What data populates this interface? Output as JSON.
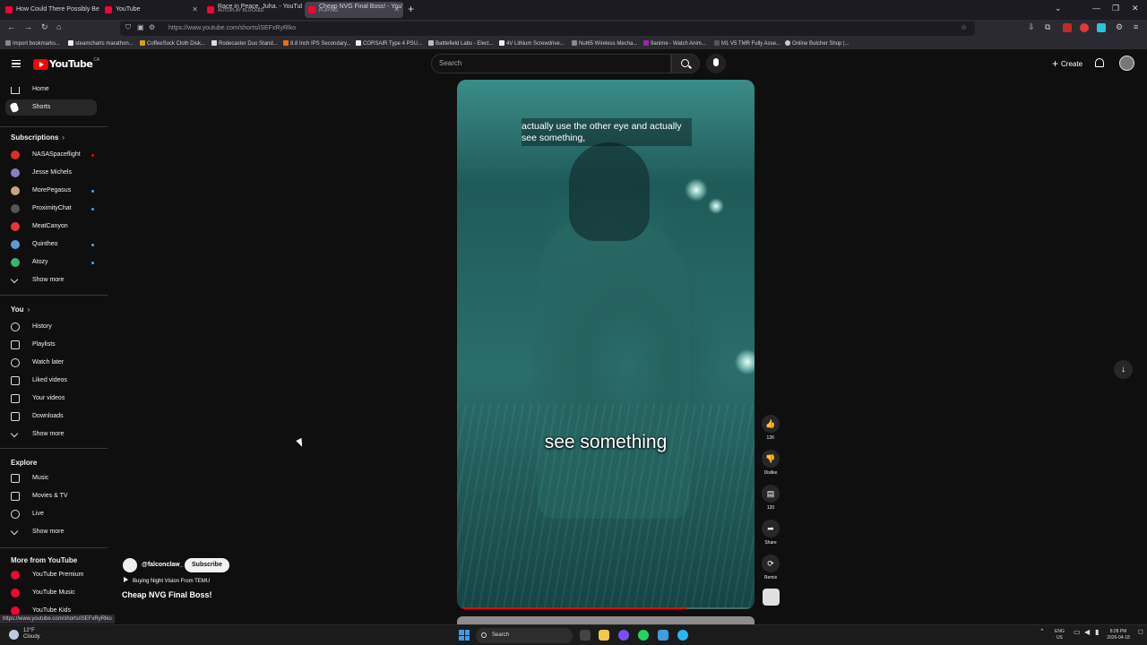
{
  "browser": {
    "tabs": [
      {
        "title": "How Could There Possibly Be A",
        "subtitle": ""
      },
      {
        "title": "YouTube",
        "subtitle": ""
      },
      {
        "title": "Race in Peace, Juha. - YouTube",
        "subtitle": "AUTOPLAY BLOCKED"
      },
      {
        "title": "Cheap NVG Final Boss! - YouTu",
        "subtitle": "PLAYING"
      }
    ],
    "url": "https://www.youtube.com/shorts/iSEFxRyRlko",
    "bookmarks": [
      "Import bookmarks...",
      "steamcharts marathon...",
      "CoffeeSock Cloth Disk...",
      "Rodecaster Duo Stand...",
      "8.8 Inch IPS Secondary...",
      "CORSAIR Type 4 PSU...",
      "Battlefield Labs - Elect...",
      "4V Lithium Screwdrive...",
      "Nut65 Wireless Mecha...",
      "9anime - Watch Anim...",
      "M1 V5 TMR Fully Asse...",
      "Online Butcher Shop |..."
    ],
    "status_url": "https://www.youtube.com/shorts/iSEFxRyRlko"
  },
  "header": {
    "logo_text": "YouTube",
    "region": "CA",
    "search_placeholder": "Search",
    "create_label": "Create"
  },
  "sidebar": {
    "main": [
      {
        "label": "Home"
      },
      {
        "label": "Shorts"
      }
    ],
    "subscriptions_heading": "Subscriptions",
    "subscriptions": [
      {
        "label": "NASASpaceflight",
        "color": "#d93025",
        "live": true
      },
      {
        "label": "Jesse Michels",
        "color": "#8e7cc3",
        "live": false
      },
      {
        "label": "MorePegasus",
        "color": "#c4a484",
        "live": true
      },
      {
        "label": "ProximityChat",
        "color": "#555555",
        "live": true
      },
      {
        "label": "MeatCanyon",
        "color": "#e53935",
        "live": false
      },
      {
        "label": "Quintheo",
        "color": "#5c9bd1",
        "live": true
      },
      {
        "label": "Atozy",
        "color": "#3bb273",
        "live": true
      },
      {
        "label": "Show more",
        "color": "",
        "live": false
      }
    ],
    "you_heading": "You",
    "you_items": [
      {
        "label": "History"
      },
      {
        "label": "Playlists"
      },
      {
        "label": "Watch later"
      },
      {
        "label": "Liked videos"
      },
      {
        "label": "Your videos"
      },
      {
        "label": "Downloads"
      },
      {
        "label": "Show more"
      }
    ],
    "explore_heading": "Explore",
    "explore_items": [
      {
        "label": "Music"
      },
      {
        "label": "Movies & TV"
      },
      {
        "label": "Live"
      },
      {
        "label": "Show more"
      }
    ],
    "more_heading": "More from YouTube",
    "more_items": [
      {
        "label": "YouTube Premium"
      },
      {
        "label": "YouTube Music"
      },
      {
        "label": "YouTube Kids"
      }
    ]
  },
  "short": {
    "caption_line1": "actually use the other eye and actually",
    "caption_line2": "see something,",
    "caption_big": "see something",
    "progress_fraction": 0.77,
    "channel": "@falconclaw_",
    "subscribe_label": "Subscribe",
    "sound": "Buying Night Vision From TEMU",
    "title": "Cheap NVG Final Boss!"
  },
  "actions": {
    "like_count": "12K",
    "dislike_label": "Dislike",
    "comment_count": "120",
    "share_label": "Share",
    "remix_label": "Remix"
  },
  "taskbar": {
    "temperature": "12°F",
    "weather": "Cloudy",
    "search_placeholder": "Search",
    "lang": "ENG",
    "region": "US",
    "time": "8:28 PM",
    "date": "2026-04-18"
  }
}
